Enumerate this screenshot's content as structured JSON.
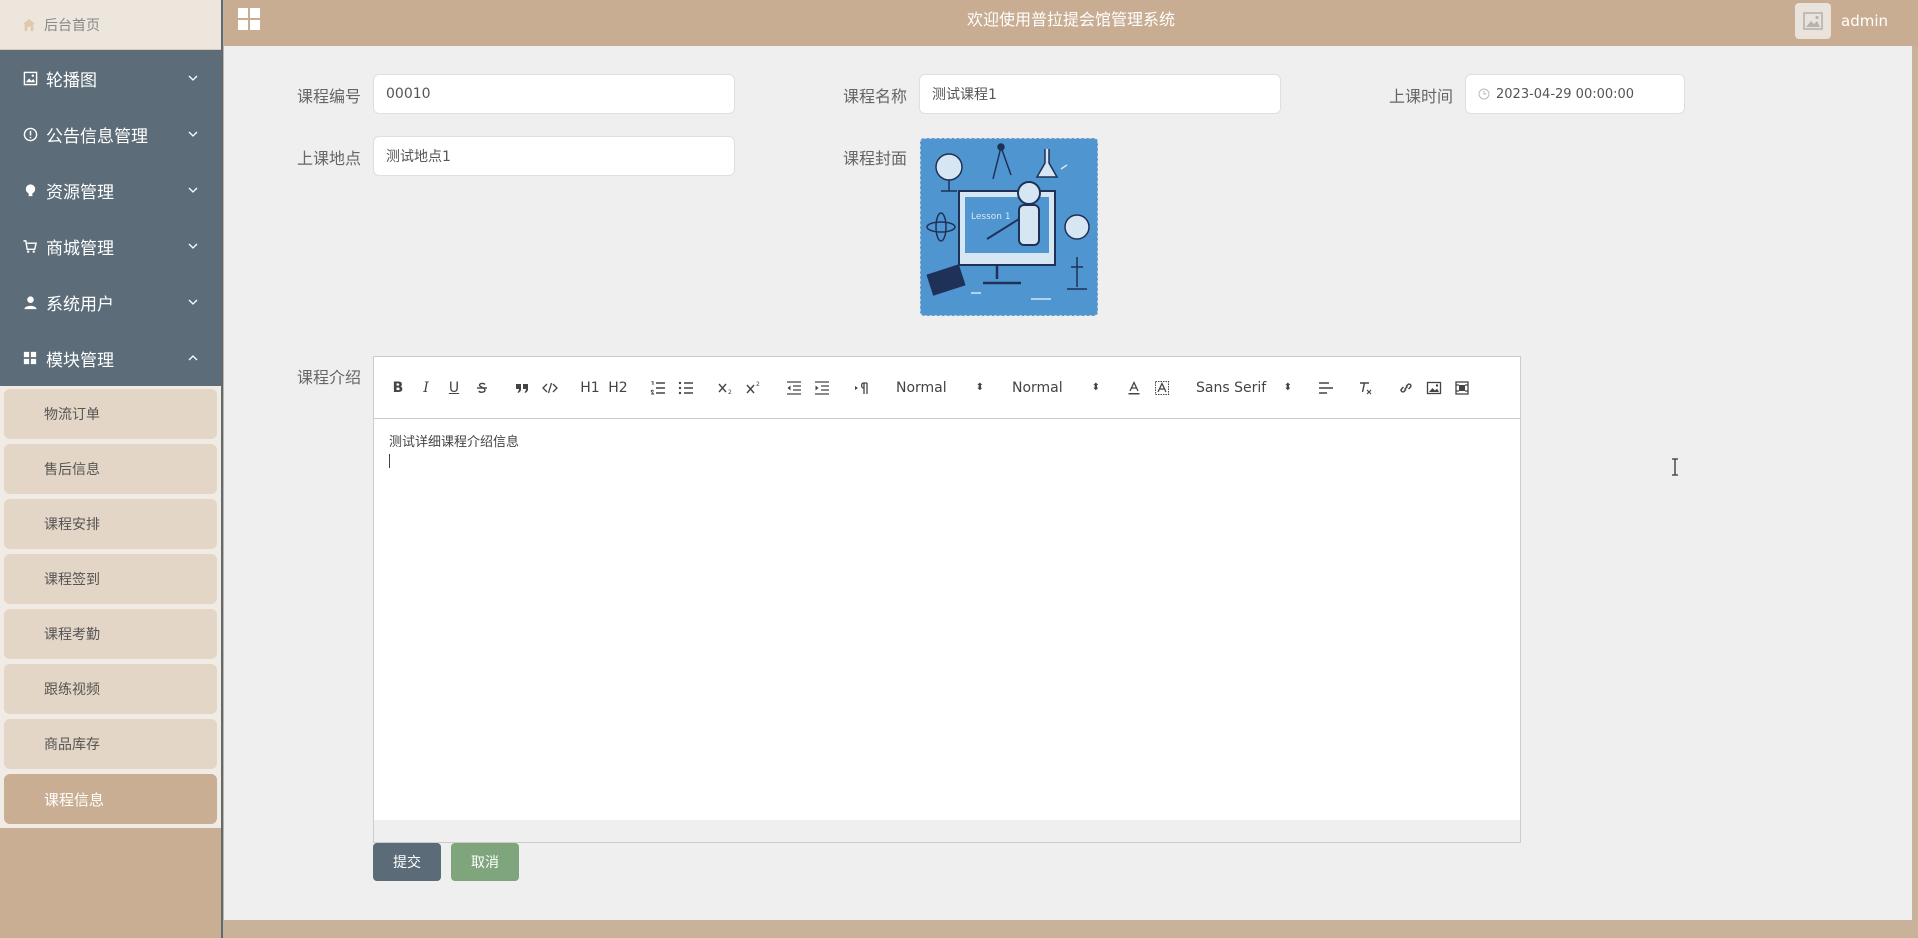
{
  "sidebar": {
    "home_label": "后台首页",
    "menu": [
      {
        "label": "轮播图",
        "icon": "picture-icon"
      },
      {
        "label": "公告信息管理",
        "icon": "info-circle-icon"
      },
      {
        "label": "资源管理",
        "icon": "lightbulb-icon"
      },
      {
        "label": "商城管理",
        "icon": "cart-icon"
      },
      {
        "label": "系统用户",
        "icon": "user-icon"
      },
      {
        "label": "模块管理",
        "icon": "grid-icon",
        "expanded": true
      }
    ],
    "submenu": [
      "物流订单",
      "售后信息",
      "课程安排",
      "课程签到",
      "课程考勤",
      "跟练视频",
      "商品库存",
      "课程信息"
    ],
    "active_submenu": "课程信息"
  },
  "header": {
    "title": "欢迎使用普拉提会馆管理系统",
    "username": "admin"
  },
  "form": {
    "course_no_label": "课程编号",
    "course_no_value": "00010",
    "course_name_label": "课程名称",
    "course_name_value": "测试课程1",
    "class_time_label": "上课时间",
    "class_time_value": "2023-04-29 00:00:00",
    "location_label": "上课地点",
    "location_value": "测试地点1",
    "cover_label": "课程封面",
    "cover_image_text": "Lesson 1",
    "intro_label": "课程介绍",
    "intro_text": "测试详细课程介绍信息",
    "toolbar": {
      "header_select": "Normal",
      "size_select": "Normal",
      "font_select": "Sans Serif",
      "h1": "H1",
      "h2": "H2"
    },
    "submit_label": "提交",
    "cancel_label": "取消"
  },
  "colors": {
    "accent": "#c9ae93",
    "sidebar_menu_bg": "#5c6d79",
    "submit": "#5b6c78",
    "cancel": "#7fa57d"
  }
}
